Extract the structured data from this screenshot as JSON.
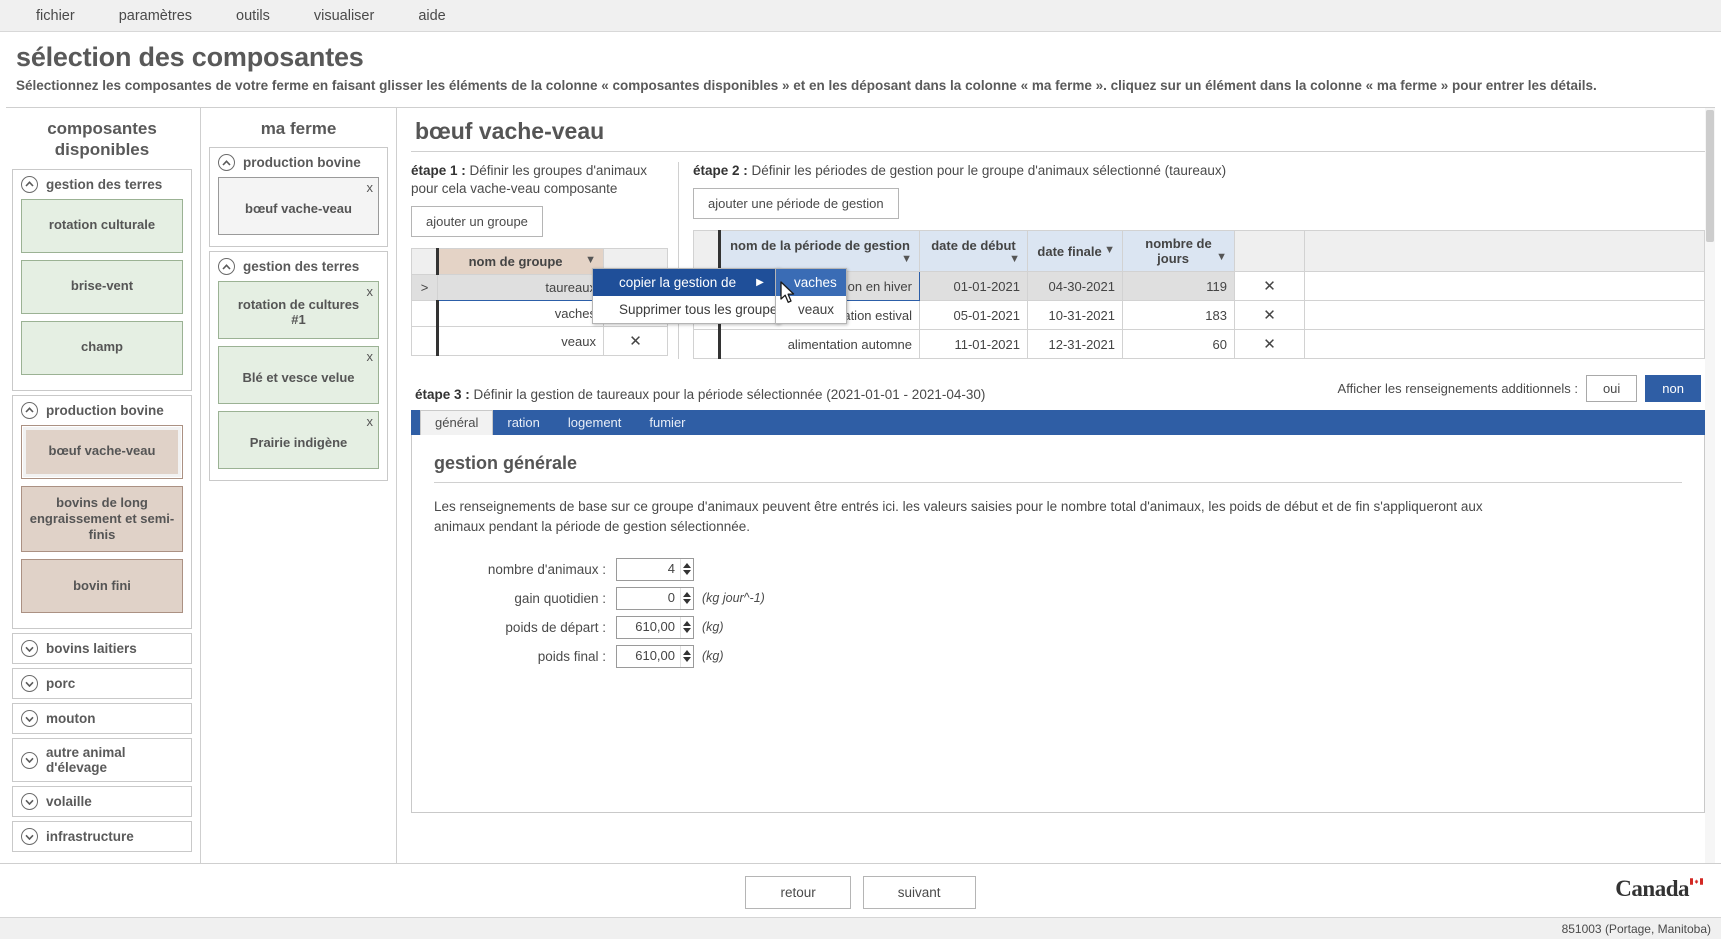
{
  "menubar": {
    "items": [
      "fichier",
      "paramètres",
      "outils",
      "visualiser",
      "aide"
    ]
  },
  "header": {
    "title": "sélection des composantes",
    "subtitle": "Sélectionnez les composantes de votre ferme en faisant glisser les éléments de la colonne « composantes disponibles » et en les déposant dans la colonne « ma ferme ». cliquez sur un élément dans la colonne « ma ferme » pour entrer les détails."
  },
  "available": {
    "title_line1": "composantes",
    "title_line2": "disponibles",
    "groups": [
      {
        "label": "gestion des terres",
        "expanded": true,
        "color": "green",
        "items": [
          "rotation culturale",
          "brise-vent",
          "champ"
        ]
      },
      {
        "label": "production bovine",
        "expanded": true,
        "color": "brown",
        "items": [
          "bœuf vache-veau",
          "bovins de long engraissement et semi-finis",
          "bovin fini"
        ]
      },
      {
        "label": "bovins laitiers",
        "expanded": false,
        "items": []
      },
      {
        "label": "porc",
        "expanded": false,
        "items": []
      },
      {
        "label": "mouton",
        "expanded": false,
        "items": []
      },
      {
        "label": "autre animal d'élevage",
        "expanded": false,
        "items": []
      },
      {
        "label": "volaille",
        "expanded": false,
        "items": []
      },
      {
        "label": "infrastructure",
        "expanded": false,
        "items": []
      }
    ]
  },
  "farm": {
    "title": "ma ferme",
    "groups": [
      {
        "label": "production bovine",
        "expanded": true,
        "color": "grey",
        "items": [
          "bœuf vache-veau"
        ]
      },
      {
        "label": "gestion des terres",
        "expanded": true,
        "color": "green",
        "items": [
          "rotation de cultures #1",
          "Blé et vesce velue",
          "Prairie indigène"
        ]
      }
    ],
    "remove_label": "x"
  },
  "detail": {
    "title": "bœuf vache-veau",
    "step1": {
      "label_bold": "étape 1 :",
      "label_rest": " Définir les groupes d'animaux pour cela vache-veau composante",
      "add_button": "ajouter un groupe",
      "columns": [
        "",
        "nom de groupe",
        ""
      ],
      "rows": [
        {
          "name": "taureaux",
          "selected": true
        },
        {
          "name": "vaches",
          "selected": false
        },
        {
          "name": "veaux",
          "selected": false
        }
      ],
      "delete_label": "✕"
    },
    "step2": {
      "label_bold": "étape 2 :",
      "label_rest": " Définir les périodes de gestion pour le groupe d'animaux sélectionné (taureaux)",
      "add_button": "ajouter une période de gestion",
      "columns": [
        "",
        "nom de la période de gestion",
        "date de début",
        "date finale",
        "nombre de jours",
        "",
        ""
      ],
      "rows": [
        {
          "name": "alimentation en hiver",
          "start": "01-01-2021",
          "end": "04-30-2021",
          "days": "119",
          "selected": true
        },
        {
          "name": "alimentation estival",
          "start": "05-01-2021",
          "end": "10-31-2021",
          "days": "183",
          "selected": false
        },
        {
          "name": "alimentation automne",
          "start": "11-01-2021",
          "end": "12-31-2021",
          "days": "60",
          "selected": false
        }
      ],
      "delete_label": "✕"
    },
    "step3": {
      "label_bold": "étape 3 :",
      "label_rest": " Définir la gestion de taureaux pour la période sélectionnée (2021-01-01 - 2021-04-30)",
      "toggle_label": "Afficher les renseignements additionnels :",
      "toggle_yes": "oui",
      "toggle_no": "non",
      "toggle_state": "non",
      "tabs": [
        {
          "label": "général",
          "active": true
        },
        {
          "label": "ration",
          "active": false
        },
        {
          "label": "logement",
          "active": false
        },
        {
          "label": "fumier",
          "active": false
        }
      ],
      "panel_title": "gestion générale",
      "panel_text": "Les renseignements de base sur ce groupe d'animaux peuvent être entrés ici. les valeurs saisies pour le nombre total d'animaux, les poids de début et de fin s'appliqueront aux animaux pendant la période de gestion sélectionnée.",
      "fields": [
        {
          "label": "nombre d'animaux :",
          "value": "4",
          "unit": ""
        },
        {
          "label": "gain quotidien :",
          "value": "0",
          "unit": "(kg jour^-1)"
        },
        {
          "label": "poids de départ :",
          "value": "610,00",
          "unit": "(kg)"
        },
        {
          "label": "poids final :",
          "value": "610,00",
          "unit": "(kg)"
        }
      ]
    }
  },
  "context_menu": {
    "items": [
      {
        "label": "copier la gestion de",
        "highlighted": true,
        "has_submenu": true,
        "arrow": "▶"
      },
      {
        "label": "Supprimer tous les groupes",
        "highlighted": false,
        "has_submenu": false,
        "arrow": ""
      }
    ],
    "submenu": [
      {
        "label": "vaches",
        "highlighted": true
      },
      {
        "label": "veaux",
        "highlighted": false
      }
    ]
  },
  "footer": {
    "back": "retour",
    "next": "suivant",
    "wordmark": "Canada"
  },
  "statusbar": {
    "text": "851003 (Portage, Manitoba)"
  },
  "colors": {
    "accent": "#2f5ea5",
    "menu_highlight": "#1f4f99",
    "submenu_highlight": "#3a6cb5",
    "green_tile": "#e5efe3",
    "brown_tile": "#e0d2c8",
    "header_brown": "#e4d3c6",
    "header_blue": "#dbe5f2"
  }
}
